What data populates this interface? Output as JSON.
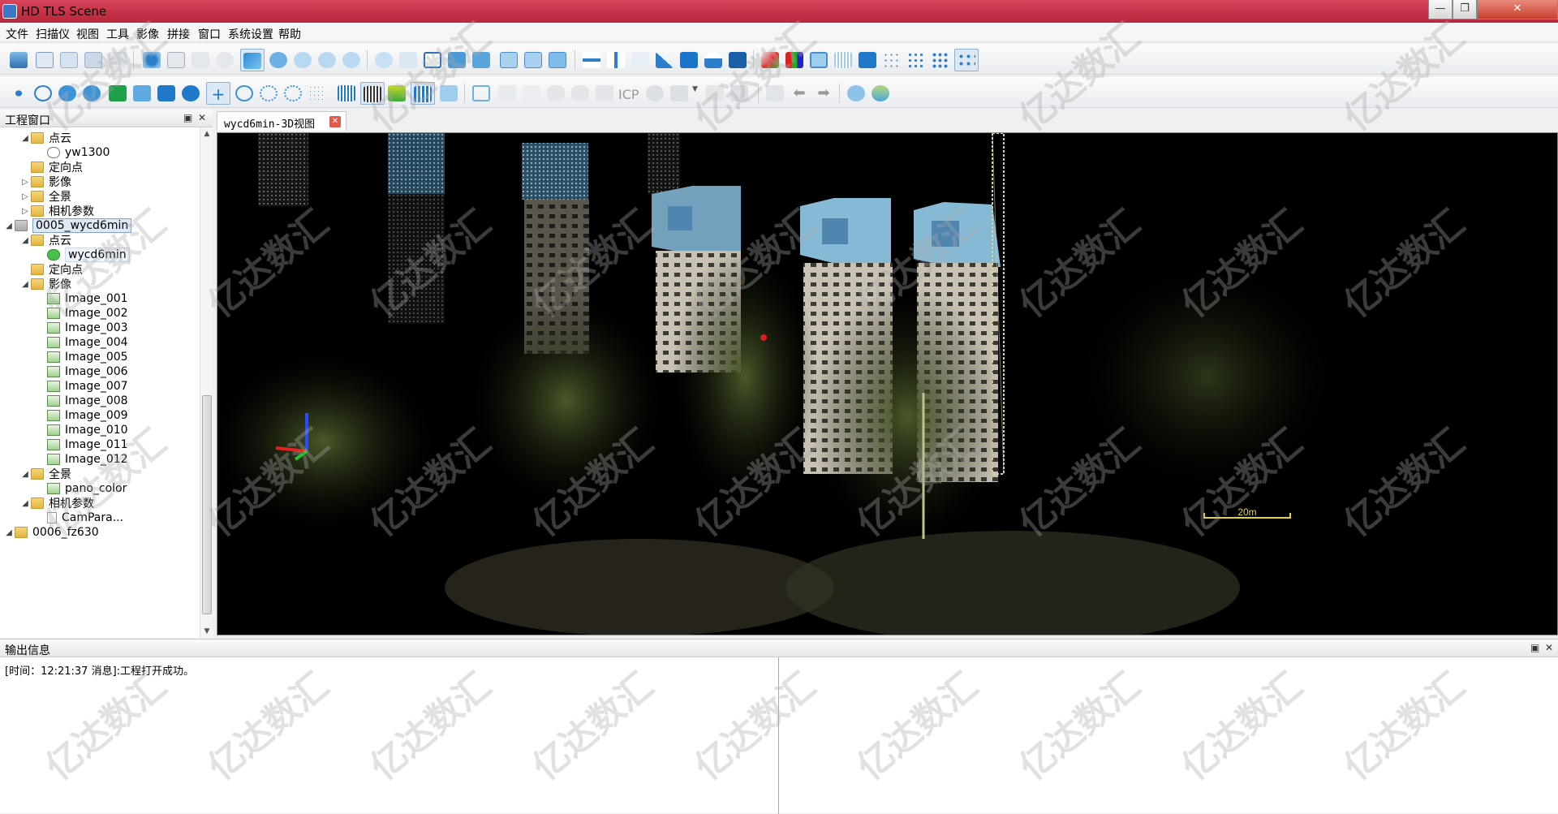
{
  "app": {
    "title": "HD TLS Scene"
  },
  "window_controls": {
    "minimize": "—",
    "maximize": "❐",
    "close": "✕"
  },
  "menu": [
    "文件",
    "扫描仪",
    "视图",
    "工具",
    "影像",
    "拼接",
    "窗口",
    "系统设置",
    "帮助"
  ],
  "toolbar2_icp_label": "ICP",
  "project_panel": {
    "title": "工程窗口",
    "tree": [
      {
        "label": "点云",
        "icon": "folder-icon",
        "expand": "◢",
        "indent": 1
      },
      {
        "label": "yw1300",
        "icon": "cloud-icon",
        "expand": "",
        "indent": 2
      },
      {
        "label": "定向点",
        "icon": "folder-icon",
        "expand": "",
        "indent": 1
      },
      {
        "label": "影像",
        "icon": "folder-icon",
        "expand": "▷",
        "indent": 1
      },
      {
        "label": "全景",
        "icon": "folder-icon",
        "expand": "▷",
        "indent": 1
      },
      {
        "label": "相机参数",
        "icon": "folder-icon",
        "expand": "▷",
        "indent": 1
      },
      {
        "label": "0005_wycd6min",
        "icon": "project-folder-icon",
        "expand": "◢",
        "indent": 0,
        "selected": true
      },
      {
        "label": "点云",
        "icon": "folder-icon",
        "expand": "◢",
        "indent": 1
      },
      {
        "label": "wycd6min",
        "icon": "cloud-green-icon",
        "expand": "",
        "indent": 2,
        "hover": true
      },
      {
        "label": "定向点",
        "icon": "folder-icon",
        "expand": "",
        "indent": 1
      },
      {
        "label": "影像",
        "icon": "folder-icon",
        "expand": "◢",
        "indent": 1
      },
      {
        "label": "Image_001",
        "icon": "image-icon",
        "expand": "",
        "indent": 2
      },
      {
        "label": "Image_002",
        "icon": "image-icon",
        "expand": "",
        "indent": 2
      },
      {
        "label": "Image_003",
        "icon": "image-icon",
        "expand": "",
        "indent": 2
      },
      {
        "label": "Image_004",
        "icon": "image-icon",
        "expand": "",
        "indent": 2
      },
      {
        "label": "Image_005",
        "icon": "image-icon",
        "expand": "",
        "indent": 2
      },
      {
        "label": "Image_006",
        "icon": "image-icon",
        "expand": "",
        "indent": 2
      },
      {
        "label": "Image_007",
        "icon": "image-icon",
        "expand": "",
        "indent": 2
      },
      {
        "label": "Image_008",
        "icon": "image-icon",
        "expand": "",
        "indent": 2
      },
      {
        "label": "Image_009",
        "icon": "image-icon",
        "expand": "",
        "indent": 2
      },
      {
        "label": "Image_010",
        "icon": "image-icon",
        "expand": "",
        "indent": 2
      },
      {
        "label": "Image_011",
        "icon": "image-icon",
        "expand": "",
        "indent": 2
      },
      {
        "label": "Image_012",
        "icon": "image-icon",
        "expand": "",
        "indent": 2
      },
      {
        "label": "全景",
        "icon": "folder-icon",
        "expand": "◢",
        "indent": 1
      },
      {
        "label": "pano_color",
        "icon": "image-icon",
        "expand": "",
        "indent": 2
      },
      {
        "label": "相机参数",
        "icon": "folder-icon",
        "expand": "◢",
        "indent": 1
      },
      {
        "label": "CamPara...",
        "icon": "file-icon",
        "expand": "",
        "indent": 2
      },
      {
        "label": "0006_fz630",
        "icon": "folder-icon",
        "expand": "◢",
        "indent": 0
      }
    ]
  },
  "view": {
    "tab_label": "wycd6min-3D视图",
    "tab_close": "✕",
    "scale_label": "20m"
  },
  "output_panel": {
    "title": "输出信息",
    "message": "[时间：12:21:37    消息]:工程打开成功。"
  },
  "watermark": "亿达数汇",
  "colors": {
    "titlebar": "#c42f45",
    "building_facade": "#c9c2b2",
    "building_top": "#7fb3cf",
    "vegetation": "#3d4a22",
    "scale_bar": "#e6d23a"
  }
}
